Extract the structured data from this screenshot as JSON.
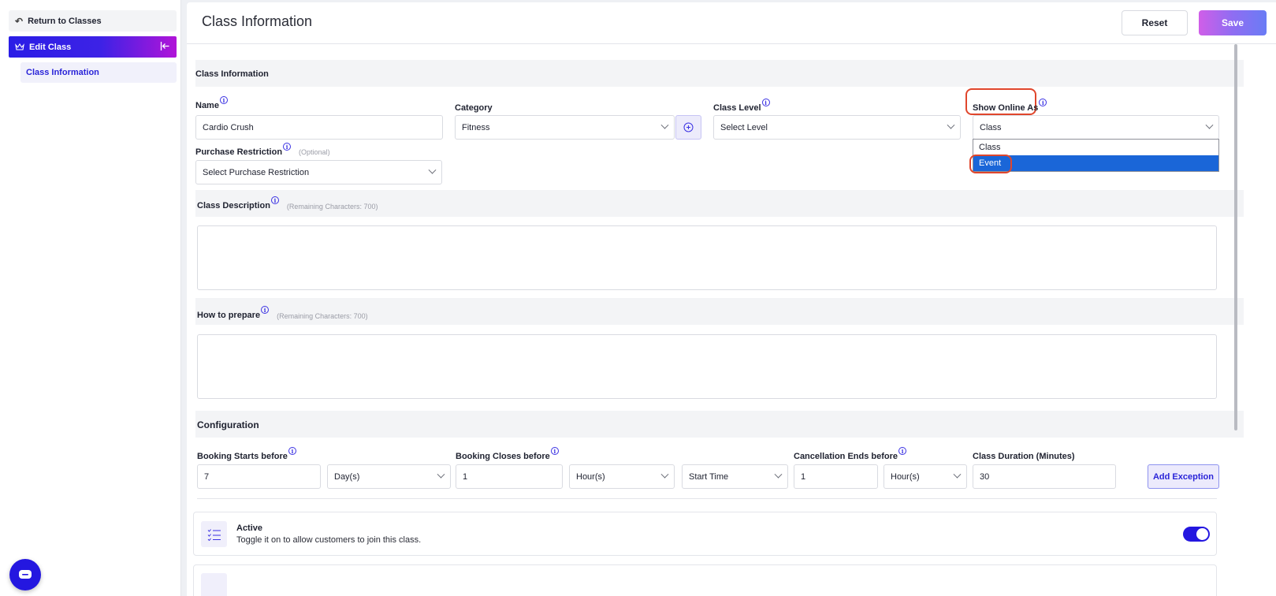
{
  "sidebar": {
    "return_label": "Return to Classes",
    "edit_label": "Edit Class",
    "items": [
      {
        "label": "Class Information"
      }
    ]
  },
  "header": {
    "title": "Class Information",
    "reset_label": "Reset",
    "save_label": "Save"
  },
  "class_info": {
    "section_title": "Class Information",
    "name": {
      "label": "Name",
      "value": "Cardio Crush"
    },
    "category": {
      "label": "Category",
      "value": "Fitness"
    },
    "class_level": {
      "label": "Class Level",
      "value": "Select Level"
    },
    "show_online_as": {
      "label": "Show Online As",
      "value": "Class",
      "options": [
        "Class",
        "Event"
      ],
      "highlighted_option": "Event"
    },
    "purchase_restriction": {
      "label": "Purchase Restriction",
      "hint": "(Optional)",
      "value": "Select Purchase Restriction"
    },
    "description": {
      "label": "Class Description",
      "hint": "(Remaining Characters: 700)",
      "value": ""
    },
    "how_to_prepare": {
      "label": "How to prepare",
      "hint": "(Remaining Characters: 700)",
      "value": ""
    }
  },
  "configuration": {
    "section_title": "Configuration",
    "booking_starts": {
      "label": "Booking Starts before",
      "value": "7",
      "unit": "Day(s)"
    },
    "booking_closes": {
      "label": "Booking Closes before",
      "value": "1",
      "unit": "Hour(s)",
      "reference": "Start Time"
    },
    "cancellation_ends": {
      "label": "Cancellation Ends before",
      "value": "1",
      "unit": "Hour(s)"
    },
    "duration": {
      "label": "Class Duration (Minutes)",
      "value": "30"
    },
    "add_exception_label": "Add Exception"
  },
  "active_card": {
    "title": "Active",
    "subtitle": "Toggle it on to allow customers to join this class.",
    "enabled": true
  },
  "colors": {
    "accent": "#2417e0",
    "highlight_ring": "#e0462c",
    "dropdown_selected": "#1a66d8"
  }
}
